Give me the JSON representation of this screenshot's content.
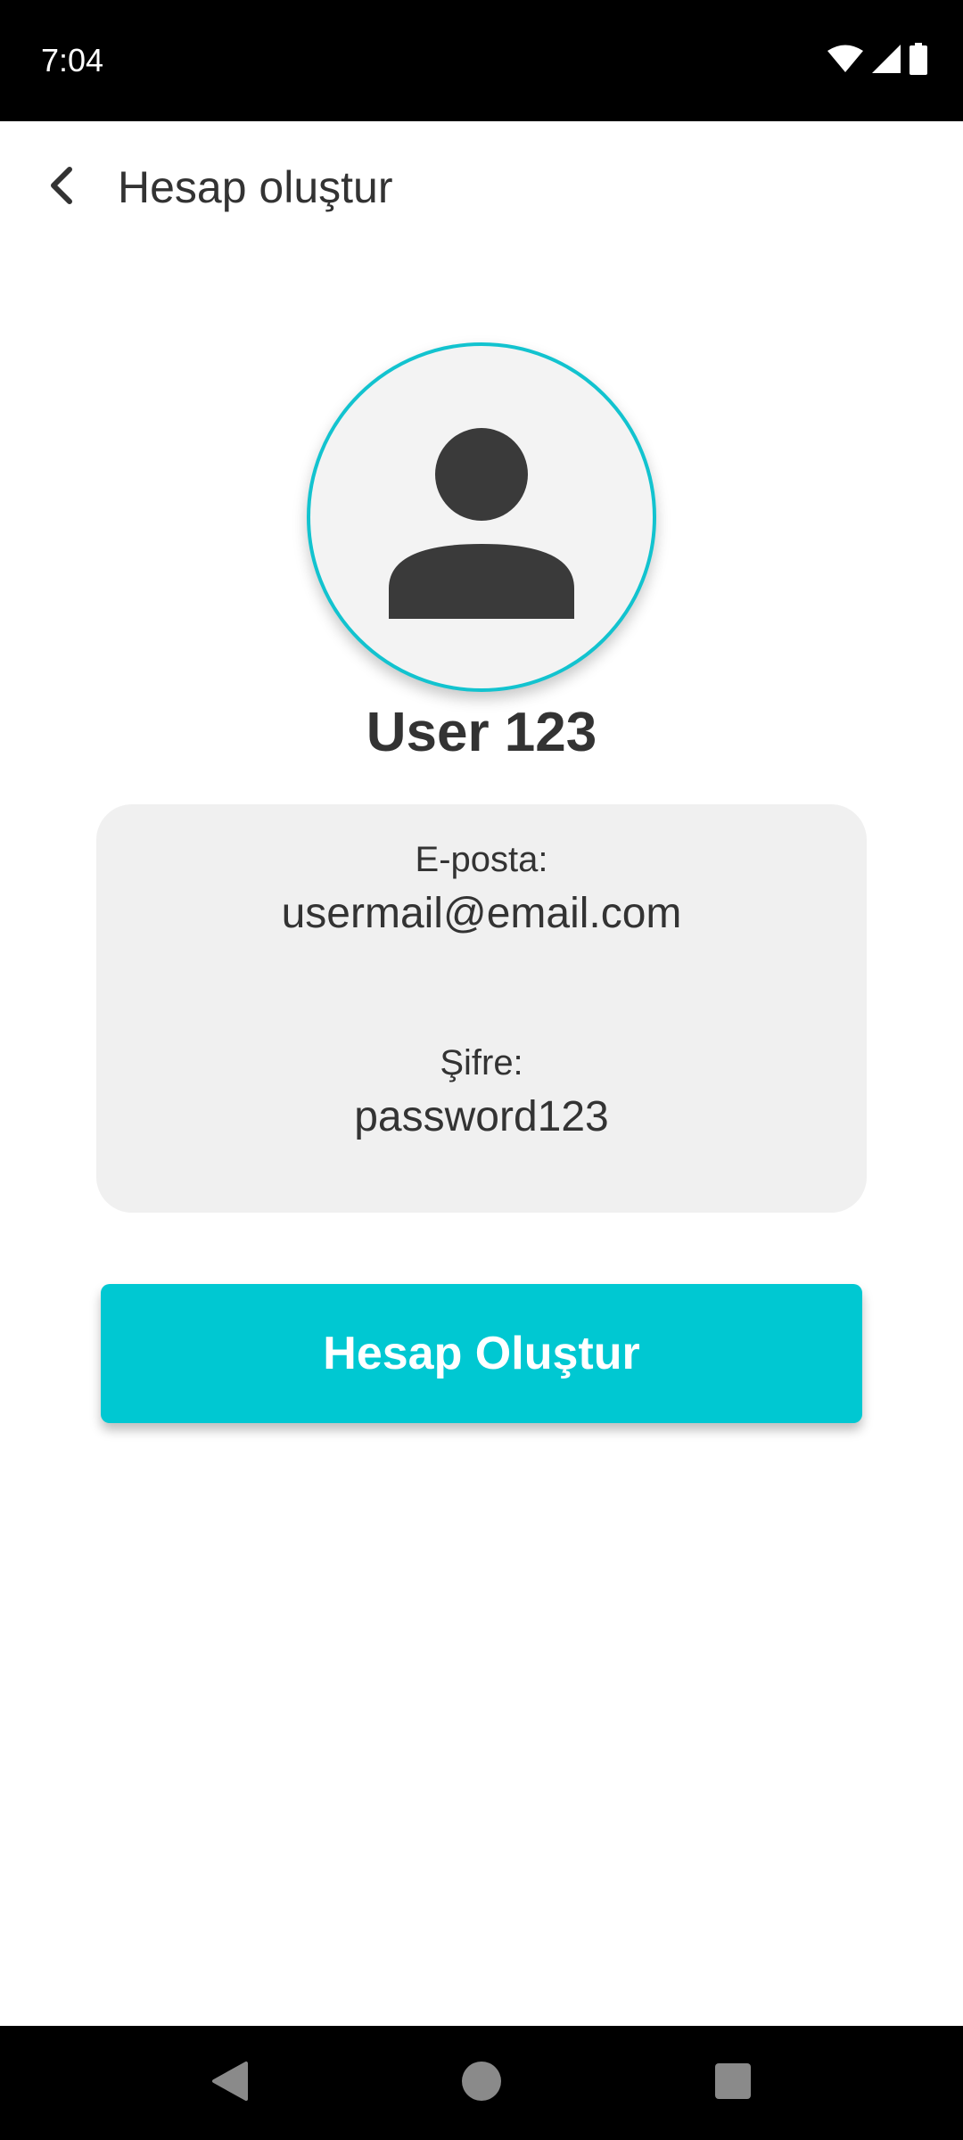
{
  "status_bar": {
    "time": "7:04",
    "icons": [
      "wifi-icon",
      "signal-icon",
      "battery-icon"
    ]
  },
  "app_bar": {
    "back_icon": "chevron-left-icon",
    "title": "Hesap oluştur"
  },
  "profile": {
    "avatar_icon": "person-icon",
    "username": "User 123"
  },
  "info_card": {
    "email_label": "E-posta:",
    "email_value": "usermail@email.com",
    "password_label": "Şifre:",
    "password_value": "password123"
  },
  "actions": {
    "create_label": "Hesap Oluştur"
  },
  "nav_bar": {
    "icons": [
      "back-triangle-icon",
      "home-circle-icon",
      "recents-square-icon"
    ]
  },
  "colors": {
    "accent": "#00c8d2",
    "avatar_ring": "#12c3cf",
    "card_bg": "#f0f0f0",
    "text": "#333333"
  }
}
